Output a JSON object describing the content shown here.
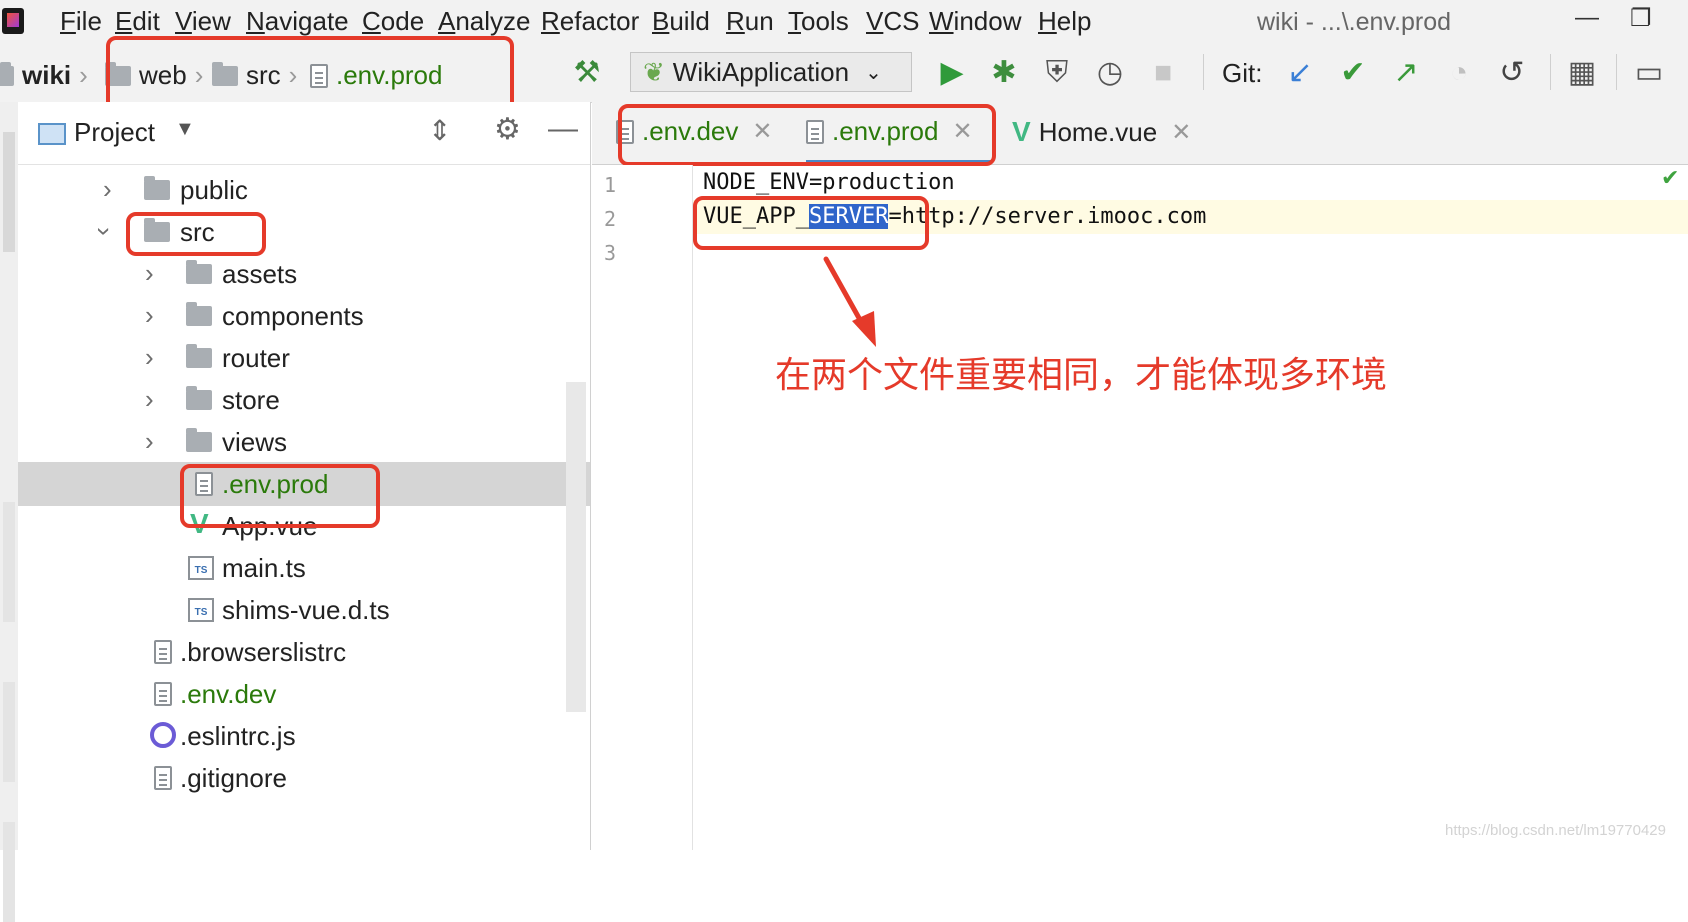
{
  "window": {
    "title": "wiki - ...\\.env.prod",
    "menu": [
      "File",
      "Edit",
      "View",
      "Navigate",
      "Code",
      "Analyze",
      "Refactor",
      "Build",
      "Run",
      "Tools",
      "VCS",
      "Window",
      "Help"
    ]
  },
  "breadcrumb": [
    "wiki",
    "web",
    "src",
    ".env.prod"
  ],
  "toolbar": {
    "run_config": "WikiApplication",
    "git_label": "Git:"
  },
  "project_panel": {
    "title": "Project",
    "tree": [
      {
        "label": "public",
        "type": "folder",
        "expanded": false
      },
      {
        "label": "src",
        "type": "folder",
        "expanded": true
      },
      {
        "label": "assets",
        "type": "folder",
        "expanded": false
      },
      {
        "label": "components",
        "type": "folder",
        "expanded": false
      },
      {
        "label": "router",
        "type": "folder",
        "expanded": false
      },
      {
        "label": "store",
        "type": "folder",
        "expanded": false
      },
      {
        "label": "views",
        "type": "folder",
        "expanded": false
      },
      {
        "label": ".env.prod",
        "type": "file",
        "selected": true
      },
      {
        "label": "App.vue",
        "type": "vue"
      },
      {
        "label": "main.ts",
        "type": "ts"
      },
      {
        "label": "shims-vue.d.ts",
        "type": "ts"
      },
      {
        "label": ".browserslistrc",
        "type": "file"
      },
      {
        "label": ".env.dev",
        "type": "file"
      },
      {
        "label": ".eslintrc.js",
        "type": "eslint"
      },
      {
        "label": ".gitignore",
        "type": "ignore"
      }
    ]
  },
  "editor": {
    "tabs": [
      {
        "label": ".env.dev",
        "active": false
      },
      {
        "label": ".env.prod",
        "active": true
      },
      {
        "label": "Home.vue",
        "active": false
      }
    ],
    "lines": [
      {
        "number": "1",
        "text": "NODE_ENV=production"
      },
      {
        "number": "2",
        "before": "VUE_APP_",
        "selected": "SERVER",
        "after": "=http://server.imooc.com"
      },
      {
        "number": "3",
        "text": ""
      }
    ]
  },
  "annotation": "在两个文件重要相同，才能体现多环境",
  "watermark": "https://blog.csdn.net/lm19770429",
  "colors": {
    "accent_red": "#e53a2a",
    "vcs_green": "#2b7a0b",
    "selection": "#2f65ca"
  }
}
